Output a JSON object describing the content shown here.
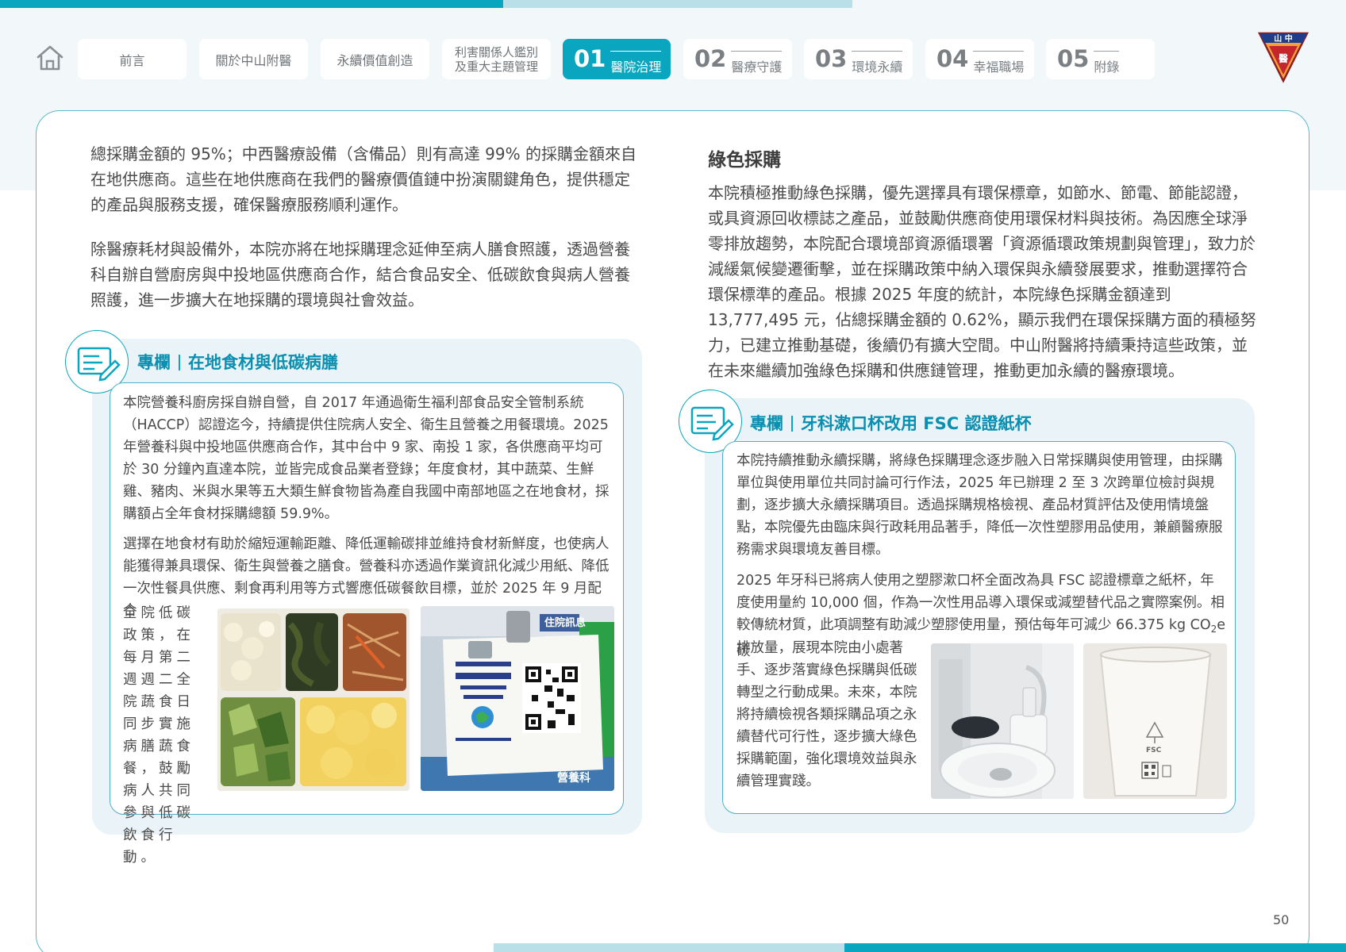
{
  "nav": {
    "tabs": [
      {
        "label": "前言"
      },
      {
        "label": "關於中山附醫"
      },
      {
        "label": "永續價值創造"
      },
      {
        "label": "利害關係人鑑別\n及重大主題管理"
      }
    ],
    "numbered": [
      {
        "num": "01",
        "label": "醫院治理"
      },
      {
        "num": "02",
        "label": "醫療守護"
      },
      {
        "num": "03",
        "label": "環境永續"
      },
      {
        "num": "04",
        "label": "幸福職場"
      },
      {
        "num": "05",
        "label": "附錄"
      }
    ],
    "logo_text": "山中醫"
  },
  "left": {
    "p1": "總採購金額的 95%；中西醫療設備（含備品）則有高達 99% 的採購金額來自在地供應商。這些在地供應商在我們的醫療價值鏈中扮演關鍵角色，提供穩定的產品與服務支援，確保醫療服務順利運作。",
    "p2": "除醫療耗材與設備外，本院亦將在地採購理念延伸至病人膳食照護，透過營養科自辦自營廚房與中投地區供應商合作，結合食品安全、低碳飲食與病人營養照護，進一步擴大在地採購的環境與社會效益。",
    "column": {
      "label": "專欄",
      "title": "在地食材與低碳病膳",
      "p1": "本院營養科廚房採自辦自營，自 2017 年通過衛生福利部食品安全管制系統（HACCP）認證迄今，持續提供住院病人安全、衛生且營養之用餐環境。2025 年營養科與中投地區供應商合作，其中台中 9 家、南投 1 家，各供應商平均可於 30 分鐘內直達本院，並皆完成食品業者登錄；年度食材，其中蔬菜、生鮮雞、豬肉、米與水果等五大類生鮮食物皆為產自我國中南部地區之在地食材，採購額占全年食材採購總額 59.9%。",
      "p2": "選擇在地食材有助於縮短運輸距離、降低運輸碳排並維持食材新鮮度，也使病人能獲得兼具環保、衛生與營養之膳食。營養科亦透過作業資訊化減少用紙、降低一次性餐具供應、剩食再利用等方式響應低碳餐飲目標，並於 2025 年 9 月配合",
      "p2_narrow": "全院低碳政策，在每月第二週週二全院蔬食日同步實施病膳蔬食餐，鼓勵病人共同參與低碳飲食行動。",
      "photo2_label": "營養科",
      "photo2_sign": "住院訊息"
    }
  },
  "right": {
    "title": "綠色採購",
    "p1": "本院積極推動綠色採購，優先選擇具有環保標章，如節水、節電、節能認證，或具資源回收標誌之產品，並鼓勵供應商使用環保材料與技術。為因應全球淨零排放趨勢，本院配合環境部資源循環署「資源循環政策規劃與管理」，致力於減緩氣候變遷衝擊，並在採購政策中納入環保與永續發展要求，推動選擇符合環保標準的產品。根據 2025 年度的統計，本院綠色採購金額達到 13,777,495 元，佔總採購金額的 0.62%，顯示我們在環保採購方面的積極努力，已建立推動基礎，後續仍有擴大空間。中山附醫將持續秉持這些政策，並在未來繼續加強綠色採購和供應鏈管理，推動更加永續的醫療環境。",
    "column": {
      "label": "專欄",
      "title": "牙科漱口杯改用 FSC 認證紙杯",
      "p1": "本院持續推動永續採購，將綠色採購理念逐步融入日常採購與使用管理，由採購單位與使用單位共同討論可行作法，2025 年已辦理 2 至 3 次跨單位檢討與規劃，逐步擴大永續採購項目。透過採購規格檢視、產品材質評估及使用情境盤點，本院優先由臨床與行政耗用品著手，降低一次性塑膠用品使用，兼顧醫療服務需求與環境友善目標。",
      "p2": "2025 年牙科已將病人使用之塑膠漱口杯全面改為具 FSC 認證標章之紙杯，年度使用量約 10,000 個，作為一次性用品導入環保或減塑替代品之實際案例。相較傳統材質，此項調整有助減少塑膠使用量，預估每年可減少 66.375 kg CO",
      "p2_sub": "2",
      "p2_end": "e 碳",
      "p3": "排放量，展現本院由小處著手、逐步落實綠色採購與低碳轉型之行動成果。未來，本院將持續檢視各類採購品項之永續替代可行性，逐步擴大綠色採購範圍，強化環境效益與永續管理實踐。",
      "cup_label": "FSC"
    }
  },
  "page_number": "50",
  "colors": {
    "accent": "#0aa5be",
    "accent_light": "#b9e0e8",
    "panel": "#eaf3f7",
    "heading": "#0a8fb0"
  }
}
